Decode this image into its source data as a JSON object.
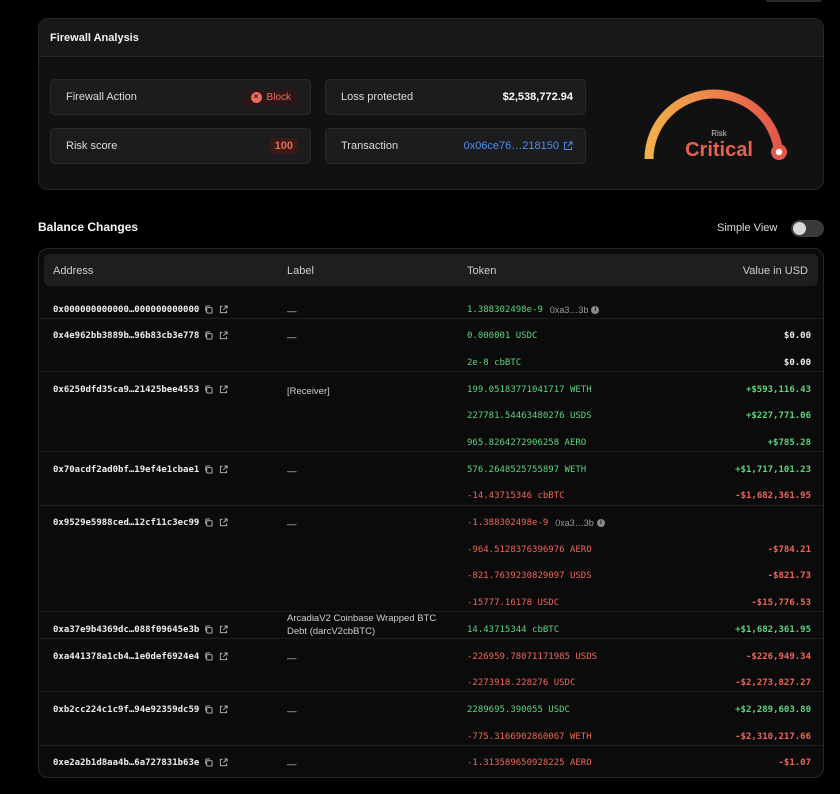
{
  "firewall": {
    "title": "Firewall Analysis",
    "action": {
      "label": "Firewall Action",
      "value": "Block"
    },
    "loss": {
      "label": "Loss protected",
      "value": "$2,538,772.94"
    },
    "risk": {
      "label": "Risk score",
      "value": "100"
    },
    "transaction": {
      "label": "Transaction",
      "value": "0x06ce76…218150"
    },
    "gauge": {
      "caption": "Risk",
      "level": "Critical",
      "score_fraction": 1.0
    },
    "colors": {
      "danger": "#ef6a5d",
      "link": "#4d8ff0",
      "gauge_start": "#f2b04a",
      "gauge_end": "#e5564b"
    }
  },
  "balance": {
    "title": "Balance Changes",
    "simple_view_label": "Simple View",
    "simple_view_on": false,
    "columns": {
      "address": "Address",
      "label": "Label",
      "token": "Token",
      "usd": "Value in USD"
    },
    "colors": {
      "positive": "#5fd47e",
      "negative": "#f0665a"
    },
    "rows": [
      {
        "address": "0x000000000000…000000000000",
        "label": "—",
        "tokens": [
          {
            "amount": "1.388302498e-9",
            "sign": "pos",
            "ref": "0xa3…3b",
            "usd": ""
          }
        ]
      },
      {
        "address": "0x4e962bb3889b…96b83cb3e778",
        "label": "—",
        "tokens": [
          {
            "amount": "0.000001 USDC",
            "sign": "pos",
            "usd": "$0.00",
            "usd_sign": "neu"
          },
          {
            "amount": "2e-8 cbBTC",
            "sign": "pos",
            "usd": "$0.00",
            "usd_sign": "neu"
          }
        ]
      },
      {
        "address": "0x6250dfd35ca9…21425bee4553",
        "label": "[Receiver]",
        "tokens": [
          {
            "amount": "199.05183771041717 WETH",
            "sign": "pos",
            "usd": "+$593,116.43",
            "usd_sign": "pos"
          },
          {
            "amount": "227781.54463480276 USDS",
            "sign": "pos",
            "usd": "+$227,771.06",
            "usd_sign": "pos"
          },
          {
            "amount": "965.8264272906258 AERO",
            "sign": "pos",
            "usd": "+$785.28",
            "usd_sign": "pos"
          }
        ]
      },
      {
        "address": "0x70acdf2ad0bf…19ef4e1cbae1",
        "label": "—",
        "tokens": [
          {
            "amount": "576.2648525755897 WETH",
            "sign": "pos",
            "usd": "+$1,717,101.23",
            "usd_sign": "pos"
          },
          {
            "amount": "-14.43715346 cbBTC",
            "sign": "neg",
            "usd": "-$1,682,361.95",
            "usd_sign": "neg"
          }
        ]
      },
      {
        "address": "0x9529e5988ced…12cf11c3ec99",
        "label": "—",
        "tokens": [
          {
            "amount": "-1.388302498e-9",
            "sign": "neg",
            "ref": "0xa3…3b",
            "usd": ""
          },
          {
            "amount": "-964.5128376396976 AERO",
            "sign": "neg",
            "usd": "-$784.21",
            "usd_sign": "neg"
          },
          {
            "amount": "-821.7639230829097 USDS",
            "sign": "neg",
            "usd": "-$821.73",
            "usd_sign": "neg"
          },
          {
            "amount": "-15777.16178 USDC",
            "sign": "neg",
            "usd": "-$15,776.53",
            "usd_sign": "neg"
          }
        ]
      },
      {
        "address": "0xa37e9b4369dc…088f09645e3b",
        "label": "ArcadiaV2 Coinbase Wrapped BTC Debt (darcV2cbBTC)",
        "tokens": [
          {
            "amount": "14.43715344 cbBTC",
            "sign": "pos",
            "usd": "+$1,682,361.95",
            "usd_sign": "pos"
          }
        ]
      },
      {
        "address": "0xa441378a1cb4…1e0def6924e4",
        "label": "—",
        "tokens": [
          {
            "amount": "-226959.78071171985 USDS",
            "sign": "neg",
            "usd": "-$226,949.34",
            "usd_sign": "neg"
          },
          {
            "amount": "-2273918.228276 USDC",
            "sign": "neg",
            "usd": "-$2,273,827.27",
            "usd_sign": "neg"
          }
        ]
      },
      {
        "address": "0xb2cc224c1c9f…94e92359dc59",
        "label": "—",
        "tokens": [
          {
            "amount": "2289695.390055 USDC",
            "sign": "pos",
            "usd": "+$2,289,603.80",
            "usd_sign": "pos"
          },
          {
            "amount": "-775.3166902860067 WETH",
            "sign": "neg",
            "usd": "-$2,310,217.66",
            "usd_sign": "neg"
          }
        ]
      },
      {
        "address": "0xe2a2b1d8aa4b…6a727831b63e",
        "label": "—",
        "tokens": [
          {
            "amount": "-1.313589650928225 AERO",
            "sign": "neg",
            "usd": "-$1.07",
            "usd_sign": "neg"
          }
        ]
      }
    ]
  }
}
